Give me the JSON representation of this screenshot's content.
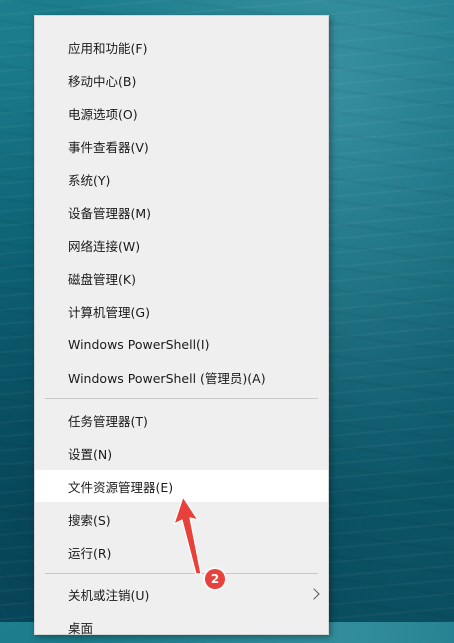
{
  "menu": {
    "items": [
      {
        "label": "应用和功能(F)"
      },
      {
        "label": "移动中心(B)"
      },
      {
        "label": "电源选项(O)"
      },
      {
        "label": "事件查看器(V)"
      },
      {
        "label": "系统(Y)"
      },
      {
        "label": "设备管理器(M)"
      },
      {
        "label": "网络连接(W)"
      },
      {
        "label": "磁盘管理(K)"
      },
      {
        "label": "计算机管理(G)"
      },
      {
        "label": "Windows PowerShell(I)"
      },
      {
        "label": "Windows PowerShell (管理员)(A)"
      },
      {
        "label": "任务管理器(T)"
      },
      {
        "label": "设置(N)"
      },
      {
        "label": "文件资源管理器(E)",
        "highlighted": true
      },
      {
        "label": "搜索(S)"
      },
      {
        "label": "运行(R)"
      },
      {
        "label": "关机或注销(U)",
        "submenu": true
      },
      {
        "label": "桌面"
      }
    ]
  },
  "annotation": {
    "badge_text": "2",
    "color": "#e8403b"
  }
}
